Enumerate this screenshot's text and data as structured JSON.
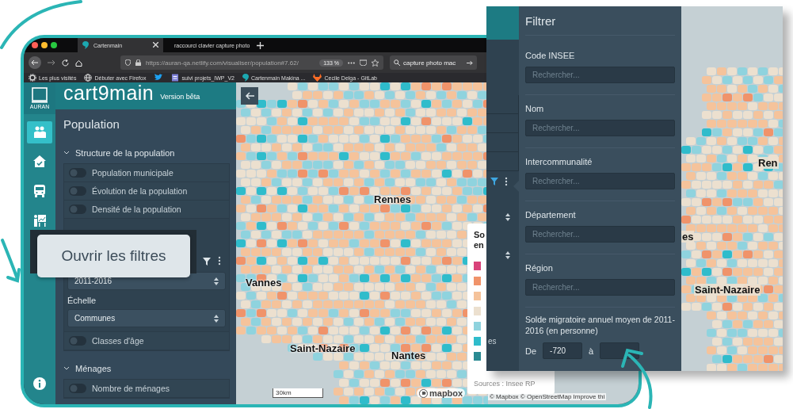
{
  "browser": {
    "tabs": [
      {
        "title": "Cartenmain",
        "selected": true
      },
      {
        "title": "raccourci clavier capture photo",
        "selected": false
      }
    ],
    "url": "https://auran-qa.netlify.com/visualiser/population#7.62/",
    "zoom": "133 %",
    "search": "capture photo mac",
    "bookmarks": [
      {
        "kind": "gear",
        "label": "Les plus visités"
      },
      {
        "kind": "globe",
        "label": "Débuter avec Firefox"
      },
      {
        "kind": "twitter"
      },
      {
        "kind": "doc",
        "label": "suivi projets_IWP_V2"
      },
      {
        "kind": "logo",
        "label": "Cartenmain Makina ..."
      },
      {
        "kind": "gitlab",
        "label": "Cecile Delga - GitLab"
      }
    ]
  },
  "app": {
    "logo": "AURAN",
    "brand": "cart9main",
    "version": "Version bêta",
    "rail": [
      {
        "kind": "people",
        "selected": true
      },
      {
        "kind": "house",
        "selected": false
      },
      {
        "kind": "bus",
        "selected": false
      },
      {
        "kind": "school",
        "selected": false
      }
    ],
    "sidebar": {
      "title": "Population",
      "sections": [
        {
          "title": "Structure de la population",
          "expanded": true,
          "items": [
            {
              "kind": "toggle",
              "label": "Population municipale",
              "on": false
            },
            {
              "kind": "toggle",
              "label": "Évolution de la population",
              "on": false
            },
            {
              "kind": "toggle",
              "label": "Densité de la population",
              "on": false
            },
            {
              "kind": "layer",
              "period": "2011-2016",
              "scale_label": "Échelle",
              "scale": "Communes"
            },
            {
              "kind": "toggle",
              "label": "Classes d'âge",
              "on": false
            }
          ]
        },
        {
          "title": "Ménages",
          "expanded": true,
          "items": [
            {
              "kind": "toggle",
              "label": "Nombre de ménages",
              "on": false
            }
          ]
        }
      ]
    }
  },
  "map": {
    "labels": [
      {
        "text": "Rennes"
      },
      {
        "text": "Vannes"
      },
      {
        "text": "Saint-Nazaire"
      },
      {
        "text": "Nantes"
      }
    ],
    "legend": {
      "title_lines": [
        "So",
        "en"
      ],
      "swatches": [
        {
          "color": "#d9437a"
        },
        {
          "color": "#f0936a"
        },
        {
          "color": "#f5c39b"
        },
        {
          "color": "#ece0cf"
        },
        {
          "color": "#8fd3de"
        },
        {
          "color": "#2fbccb"
        },
        {
          "color": "#2a8a92"
        }
      ],
      "source": "Sources : Insee RP"
    },
    "scale": "30km",
    "attribution": "mapbox",
    "credits": "© Mapbox © OpenStreetMap Improve thi"
  },
  "tooltip": "Ouvrir les filtres",
  "filter_window": {
    "strip_text": "es",
    "title": "Filtrer",
    "fields": [
      {
        "label": "Code INSEE",
        "placeholder": "Rechercher..."
      },
      {
        "label": "Nom",
        "placeholder": "Rechercher..."
      },
      {
        "label": "Intercommunalité",
        "placeholder": "Rechercher..."
      },
      {
        "label": "Département",
        "placeholder": "Rechercher..."
      },
      {
        "label": "Région",
        "placeholder": "Rechercher..."
      }
    ],
    "range": {
      "label": "Solde migratoire annuel moyen de 2011-2016 (en personne)",
      "from_label": "De",
      "from": "-720",
      "to_label": "à"
    },
    "map_labels": [
      {
        "text": "Ren"
      },
      {
        "text": "es"
      },
      {
        "text": "Saint-Nazaire"
      }
    ]
  }
}
